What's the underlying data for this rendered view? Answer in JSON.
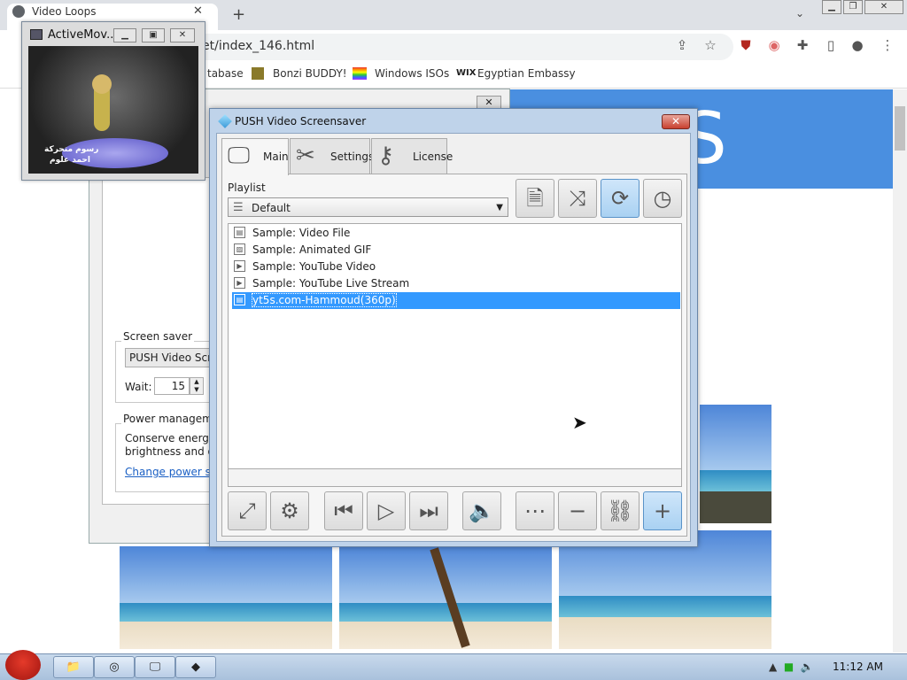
{
  "browser": {
    "tab_title": "Video Loops",
    "tab_close": "✕",
    "new_tab": "+",
    "tab_search": "⌄",
    "url": "et/index_146.html",
    "bookmarks": [
      "tabase",
      "Bonzi BUDDY!",
      "Windows ISOs",
      "Egyptian Embassy"
    ],
    "colors": {
      "banner": "#4a8fe0"
    }
  },
  "display_dialog": {
    "screen_saver_label": "Screen saver",
    "screen_saver_value": "PUSH Video Scree",
    "wait_label": "Wait:",
    "wait_value": "15",
    "power_label": "Power manageme",
    "power_text1": "Conserve energy o",
    "power_text2": "brightness and oth",
    "power_link": "Change power set"
  },
  "activemovie": {
    "title": "ActiveMov...",
    "caption_line1": "رسوم متحركة",
    "caption_line2": "احمد علوم"
  },
  "push": {
    "title": "PUSH Video Screensaver",
    "tabs": [
      {
        "label": "Main",
        "icon": "monitor-icon",
        "active": true
      },
      {
        "label": "Settings",
        "icon": "tools-icon",
        "active": false
      },
      {
        "label": "License",
        "icon": "key-icon",
        "active": false
      }
    ],
    "playlist_label": "Playlist",
    "playlist_value": "Default",
    "items": [
      {
        "label": "Sample: Video File",
        "icon": "film-icon",
        "selected": false
      },
      {
        "label": "Sample: Animated GIF",
        "icon": "image-icon",
        "selected": false
      },
      {
        "label": "Sample: YouTube Video",
        "icon": "play-icon",
        "selected": false
      },
      {
        "label": "Sample: YouTube Live Stream",
        "icon": "play-icon",
        "selected": false
      },
      {
        "label": "yt5s.com-Hammoud(360p)",
        "icon": "film-icon",
        "selected": true
      }
    ]
  },
  "taskbar": {
    "clock": "11:12 AM"
  }
}
